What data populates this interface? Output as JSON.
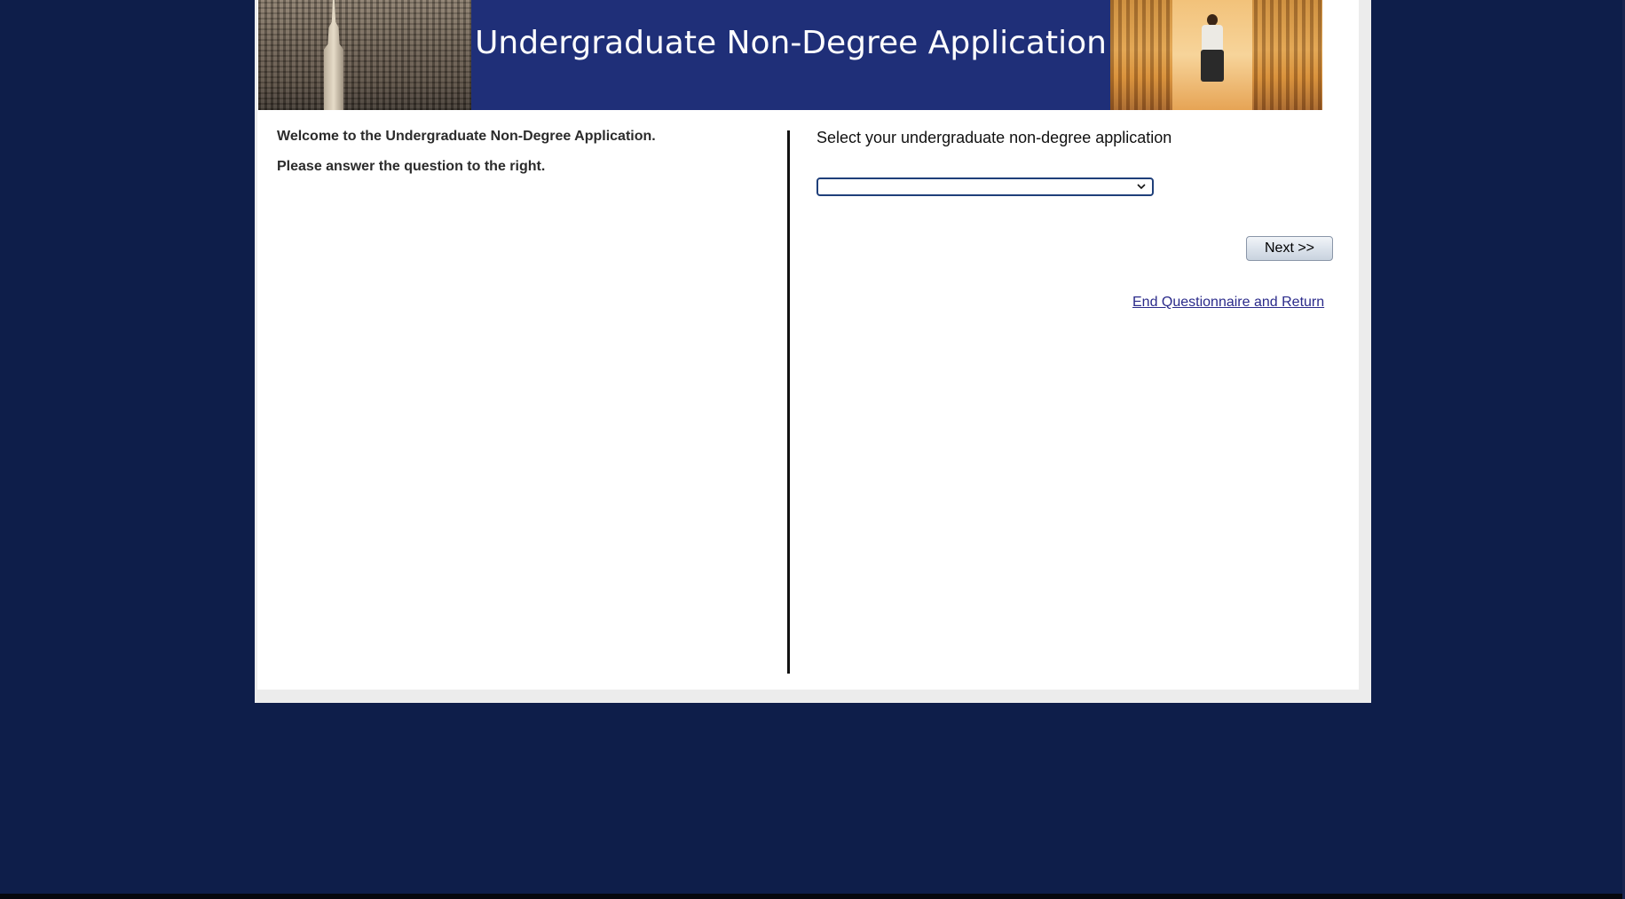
{
  "banner": {
    "title": "Undergraduate Non-Degree Application",
    "left_photo": "city-skyline-photo",
    "right_photo": "library-student-photo"
  },
  "left_panel": {
    "welcome": "Welcome to the Undergraduate Non-Degree Application.",
    "instruction": "Please answer the question to the right."
  },
  "right_panel": {
    "question": "Select your undergraduate non-degree application",
    "select": {
      "selected_value": "",
      "icon": "chevron-down-icon"
    },
    "next_label": "Next >>",
    "end_link": "End Questionnaire and Return"
  },
  "colors": {
    "page_background": "#0e1e4a",
    "banner_background": "#1f2f78",
    "panel_background": "#ffffff",
    "link": "#2a2a8a",
    "select_border": "#1f3f7a"
  }
}
